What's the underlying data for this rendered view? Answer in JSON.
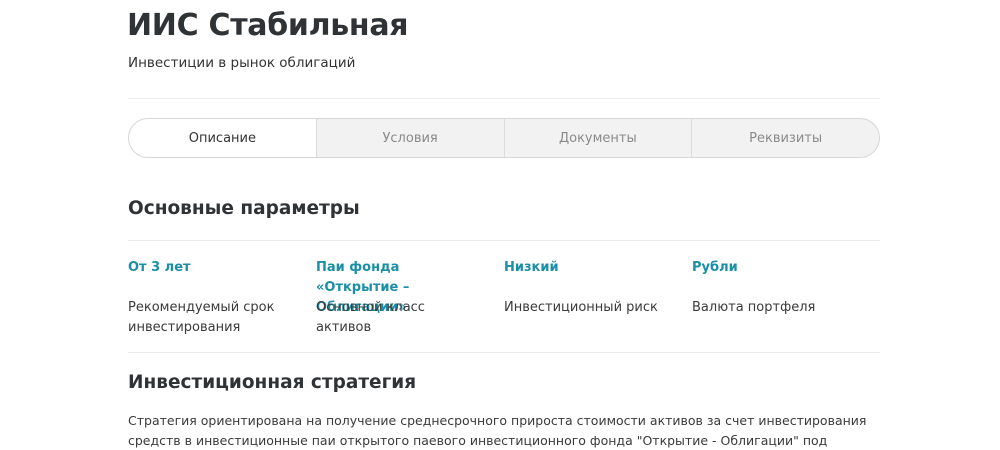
{
  "header": {
    "title": "ИИС Стабильная",
    "subtitle": "Инвестиции в рынок облигаций"
  },
  "tabs": [
    {
      "label": "Описание",
      "active": true
    },
    {
      "label": "Условия",
      "active": false
    },
    {
      "label": "Документы",
      "active": false
    },
    {
      "label": "Реквизиты",
      "active": false
    }
  ],
  "main_params": {
    "title": "Основные параметры",
    "items": [
      {
        "value": "От 3 лет",
        "label": "Рекомендуемый срок инвестирования"
      },
      {
        "value": "Паи фонда «Открытие – Облигации»",
        "label": "Основной класс активов"
      },
      {
        "value": "Низкий",
        "label": "Инвестиционный риск"
      },
      {
        "value": "Рубли",
        "label": "Валюта портфеля"
      }
    ]
  },
  "strategy": {
    "title": "Инвестиционная стратегия",
    "text": "Стратегия ориентирована на получение среднесрочного прироста стоимости активов за счет инвестирования средств в инвестиционные паи открытого паевого инвестиционного фонда \"Открытие - Облигации\" под управлением ООО УК «ОТКРЫТИЕ»."
  },
  "colors": {
    "accent": "#1b8fa5",
    "heading": "#2f3336",
    "tab_bg": "#f2f2f2"
  }
}
